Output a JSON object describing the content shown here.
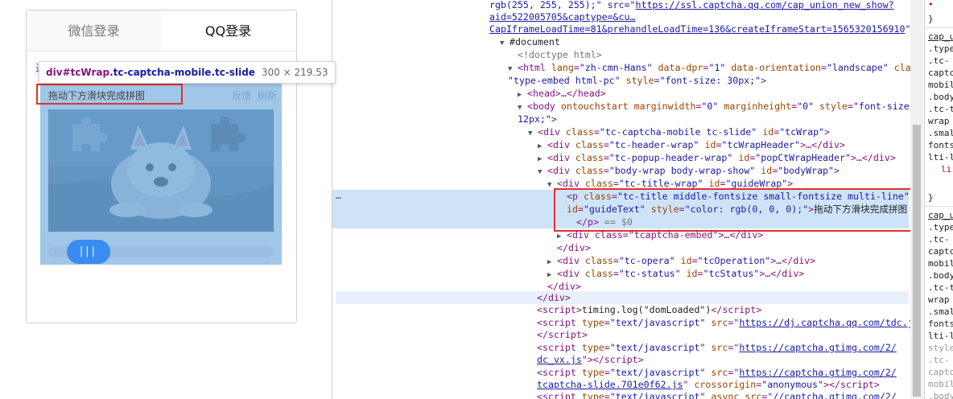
{
  "login": {
    "tabs": [
      {
        "label": "微信登录"
      },
      {
        "label": "QQ登录"
      }
    ],
    "stub_char": "这",
    "tooltip": {
      "tag": "div",
      "id": "#tcWrap",
      "classes": ".tc-captcha-mobile.tc-slide",
      "size": "300 × 219.53"
    },
    "hint": "拖动下方滑块完成拼图",
    "actions": {
      "feedback": "反馈",
      "refresh": "刷新"
    },
    "slider_grip": "|||"
  },
  "tree": {
    "l1": "rgb(255, 255, 255);\" src=\"",
    "l1_link": "https://ssl.captcha.qq.com/cap_union_new_show?",
    "l2_link": "aid=522005705&captype=&cu…",
    "l3_link": "CapIframeLoadTime=81&prehandleLoadTime=136&createIframeStart=1565320156910",
    "l3_end": "\">",
    "document": "#document",
    "doctype": "<!doctype html>",
    "html_open": "<html",
    "html_attrs": [
      {
        "n": "lang",
        "v": "\"zh-cmn-Hans\""
      },
      {
        "n": "data-dpr",
        "v": "\"1\""
      },
      {
        "n": "data-orientation",
        "v": "\"landscape\""
      },
      {
        "n": "class",
        "v": "="
      }
    ],
    "html_cont": "\"type-embed html-pc\"",
    "html_style_n": "style",
    "html_style_v": "\"font-size: 30px;\"",
    "head": "<head>…</head>",
    "body_open": "<body",
    "body_attr1": "ontouchstart",
    "body_attr2": "marginwidth",
    "body_v2": "\"0\"",
    "body_attr3": "marginheight",
    "body_v3": "\"0\"",
    "body_attr4": "style",
    "body_v4": "\"font-size:",
    "body_cont": "12px;\"",
    "rows": [
      {
        "pre": "<div",
        "attr": "class",
        "val": "\"tc-captcha-mobile tc-slide\"",
        "attr2": "id",
        "val2": "\"tcWrap\"",
        "post": ">"
      },
      {
        "pre": "<div",
        "attr": "class",
        "val": "\"tc-header-wrap\"",
        "attr2": "id",
        "val2": "\"tcWrapHeader\"",
        "post": ">…</div>"
      },
      {
        "pre": "<div",
        "attr": "class",
        "val": "\"tc-popup-header-wrap\"",
        "attr2": "id",
        "val2": "\"popCtWrapHeader\"",
        "post": ">…</div>"
      },
      {
        "pre": "<div",
        "attr": "class",
        "val": "\"body-wrap body-wrap-show\"",
        "attr2": "id",
        "val2": "\"bodyWrap\"",
        "post": ">"
      },
      {
        "pre": "<div",
        "attr": "class",
        "val": "\"tc-title-wrap\"",
        "attr2": "id",
        "val2": "\"guideWrap\"",
        "post": ">"
      }
    ],
    "p_line1_tag": "<p",
    "p_line1_attr": "class",
    "p_line1_val": "\"tc-title middle-fontsize small-fontsize multi-line\"",
    "p_line2_attr1": "id",
    "p_line2_val1": "\"guideText\"",
    "p_line2_attr2": "style",
    "p_line2_val2": "\"color: rgb(0, 0, 0);\"",
    "p_line2_close": ">",
    "p_text": "拖动下方滑块完成拼图",
    "p_line3": "</p>",
    "p_line3_eq": " == $0",
    "embed_row": "<div class=\"tcaptcha-embed\">…</div>",
    "div_close": "</div>",
    "opera_row": {
      "pre": "<div",
      "attr": "class",
      "val": "\"tc-opera\"",
      "attr2": "id",
      "val2": "\"tcOperation\"",
      "post": ">…</div>"
    },
    "status_row": {
      "pre": "<div",
      "attr": "class",
      "val": "\"tc-status\"",
      "attr2": "id",
      "val2": "\"tcStatus\"",
      "post": ">…</div>"
    },
    "script_timing": "timing.log(\"domLoaded\")",
    "scripts": [
      {
        "type": "\"text/javascript\"",
        "src": "https://dj.captcha.qq.com/tdc.js",
        "src2": "",
        "extra": ""
      },
      {
        "type": "\"text/javascript\"",
        "src": "https://captcha.gtimg.com/2/",
        "src2": "dc_vx.js",
        "extra": ""
      },
      {
        "type": "\"text/javascript\"",
        "src": "https://captcha.gtimg.com/2/",
        "src2": "tcaptcha-slide.701e0f62.js",
        "extra": "crossorigin"
      },
      {
        "type": "\"text/javascript\"",
        "src": "//captcha.gtimg.com/2/",
        "src2": "",
        "extra": "async"
      }
    ],
    "crossorigin_val": "\"anonymous\"",
    "ellipsis": "…"
  },
  "styles": {
    "lines": [
      "}",
      "cap_u",
      ".type",
      ".tc-",
      "captc",
      "mobil",
      ".body",
      ".tc-t",
      "wrap",
      ".smal",
      "fonts",
      "lti-l",
      "li",
      "}",
      "cap_u",
      ".type",
      ".tc-",
      "captc",
      "mobil",
      ".body",
      ".tc-t",
      "wrap",
      ".smal",
      "fonts",
      "lti-l",
      "}",
      "style",
      ".tc-",
      "captc",
      "mobil",
      ".body",
      ".tc-t"
    ]
  }
}
